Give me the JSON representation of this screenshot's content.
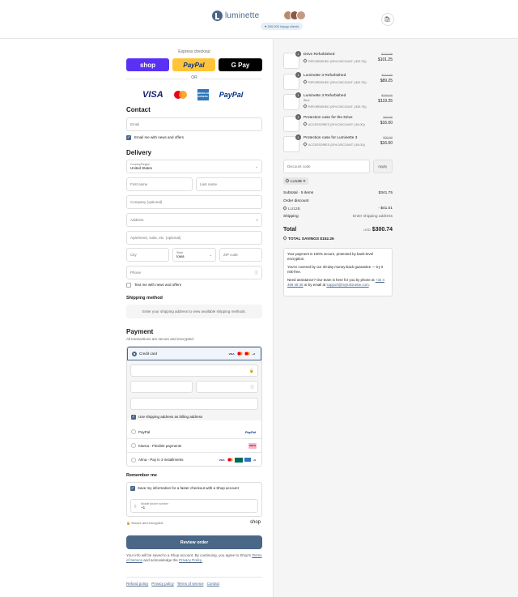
{
  "brand": {
    "name": "luminette",
    "color": "#4a6788"
  },
  "header": {
    "happy_clients": "300,000 happy clients"
  },
  "express": {
    "label": "Express checkout",
    "shop_label": "shop",
    "paypal_label": "PayPal",
    "gpay_label": "G Pay",
    "or_label": "OR"
  },
  "card_logos": {
    "visa": "VISA",
    "amex": "AMERICAN EXPRESS",
    "paypal": "PayPal"
  },
  "contact": {
    "title": "Contact",
    "email_placeholder": "Email",
    "news_label": "Email me with news and offers",
    "news_checked": true
  },
  "delivery": {
    "title": "Delivery",
    "country_label": "Country/Region",
    "country_value": "United States",
    "first_name": "First name",
    "last_name": "Last name",
    "company": "Company (optional)",
    "address": "Address",
    "apartment": "Apartment, suite, etc. (optional)",
    "city": "City",
    "state_label": "State",
    "state_value": "Iowa",
    "zip": "ZIP code",
    "phone": "Phone",
    "text_news_label": "Text me with news and offers",
    "text_news_checked": false
  },
  "shipping": {
    "title": "Shipping method",
    "notice": "Enter your shipping address to view available shipping methods."
  },
  "payment": {
    "title": "Payment",
    "subtitle": "All transactions are secure and encrypted.",
    "credit_card_label": "Credit card",
    "more_cards": "+2",
    "billing_label": "Use shipping address as billing address",
    "paypal_label": "PayPal",
    "klarna_label": "Klarna - Flexible payments",
    "klarna_badge": "Klarna",
    "alma_label": "Alma - Pay in 3 installments",
    "alma_more": "+5"
  },
  "remember": {
    "title": "Remember me",
    "save_label": "Save my information for a faster checkout with a Shop account",
    "mobile_label": "Mobile phone number",
    "mobile_value": "+1",
    "secure_label": "Secure and encrypted",
    "shop_logo": "shop"
  },
  "review_button": "Review order",
  "legal": {
    "text1": "Your info will be saved to a Shop account. By continuing, you agree to Shop's",
    "terms": "Terms of Service",
    "text2": "and acknowledge the",
    "privacy": "Privacy Policy."
  },
  "footer": [
    "Refund policy",
    "Privacy policy",
    "Terms of service",
    "Contact"
  ],
  "products": [
    {
      "name": "Drive Refurbished",
      "variant": "",
      "qty": "1",
      "tag": "REFURBISHED (25% DISCOUNT (-$33.75))",
      "orig": "$134.99",
      "price": "$101.25"
    },
    {
      "name": "Luminette 3 Refurbished",
      "variant": "",
      "qty": "1",
      "tag": "REFURBISHED (25% DISCOUNT (-$29.75))",
      "orig": "$119.00",
      "price": "$89.25"
    },
    {
      "name": "Luminette 3 Refurbished",
      "variant": "Blue",
      "qty": "1",
      "tag": "REFURBISHED (25% DISCOUNT (-$39.75))",
      "orig": "$159.00",
      "price": "$119.25"
    },
    {
      "name": "Protection case for the Drive",
      "variant": "",
      "qty": "1",
      "tag": "ACCESSORIES (20% DISCOUNT (-$4.00))",
      "orig": "$20.00",
      "price": "$16.00"
    },
    {
      "name": "Protection case for Luminette 3",
      "variant": "",
      "qty": "1",
      "tag": "ACCESSORIES (20% DISCOUNT (-$4.00))",
      "orig": "$20.00",
      "price": "$16.00"
    }
  ],
  "discount": {
    "placeholder": "Discount code",
    "apply": "Apply",
    "applied_code": "LU12B"
  },
  "summary": {
    "subtotal_label": "Subtotal · 5 items",
    "subtotal": "$341.75",
    "order_discount_label": "Order discount",
    "discount_code": "LU12B",
    "discount_value": "- $41.01",
    "shipping_label": "Shipping",
    "shipping_value": "Enter shipping address",
    "total_label": "Total",
    "currency": "USD",
    "total": "$300.74",
    "savings_label": "TOTAL SAVINGS",
    "savings": "$152.26"
  },
  "info": {
    "secure": "Your payment is 100% secure, protected by bank-level encryption.",
    "guarantee": "You're covered by our 30-day money-back guarantee — try it risk-free.",
    "help_pre": "Need assistance? Our team is here for you by phone at",
    "phone": "+32 4 369 48 36",
    "help_mid": "or by email at",
    "email": "support@myluminette.com",
    "help_end": "."
  }
}
